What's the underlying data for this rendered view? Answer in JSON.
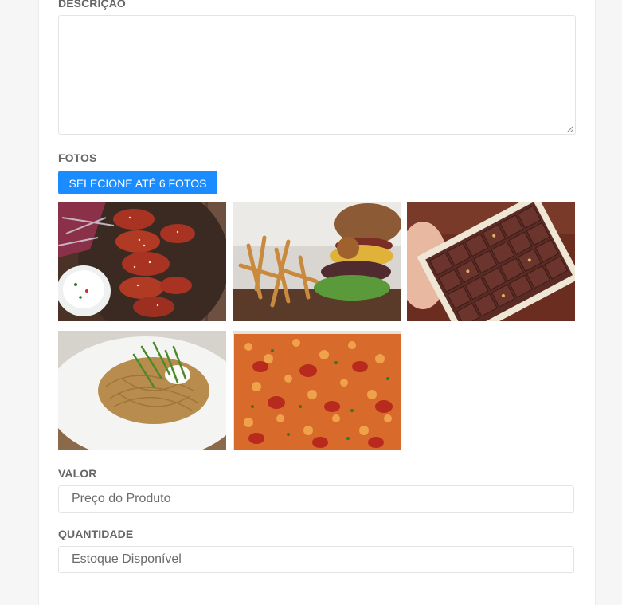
{
  "form": {
    "description_label": "DESCRIÇÃO",
    "description_value": "",
    "photos_label": "FOTOS",
    "upload_button": "SELECIONE ATÉ 6 FOTOS",
    "photos": [
      {
        "name": "photo-chicken-wings",
        "subject": "chicken wings with dip"
      },
      {
        "name": "photo-burger-fries",
        "subject": "burger with fries"
      },
      {
        "name": "photo-chocolates",
        "subject": "box of chocolates"
      },
      {
        "name": "photo-pasta",
        "subject": "spaghetti with egg and arugula"
      },
      {
        "name": "photo-pasta-bake",
        "subject": "baked pasta with pepperoni"
      }
    ],
    "value_label": "VALOR",
    "value_placeholder": "Preço do Produto",
    "quantity_label": "QUANTIDADE",
    "quantity_placeholder": "Estoque Disponível"
  },
  "colors": {
    "page_background": "#f6f6f6",
    "card_background": "#ffffff",
    "button_primary": "#1a8cff",
    "label_text": "#666666"
  }
}
